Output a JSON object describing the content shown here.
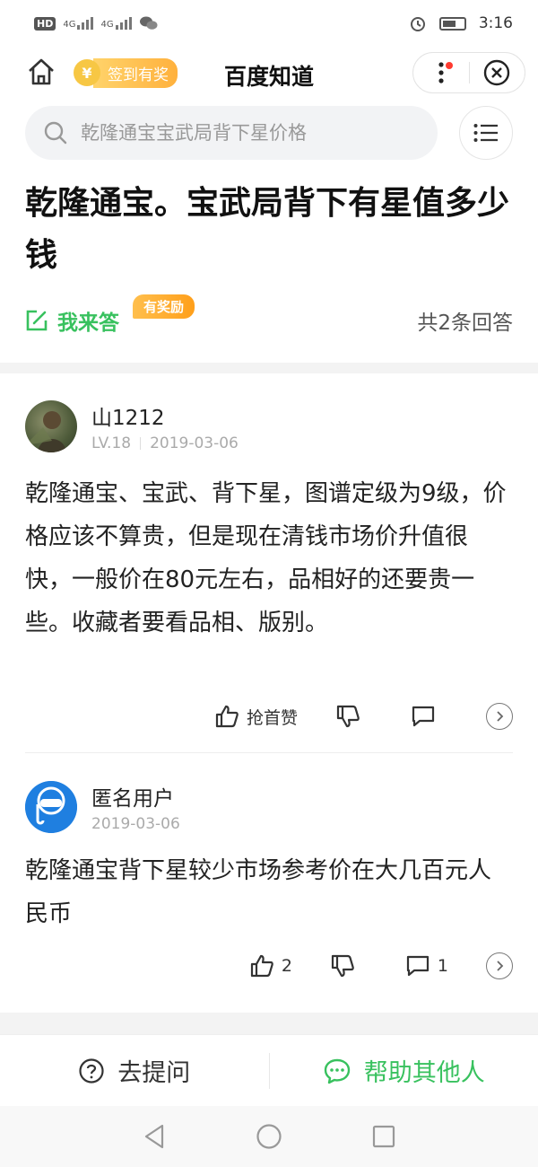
{
  "status_bar": {
    "hd": "HD",
    "net1": "4G",
    "net2": "4G",
    "time": "3:16"
  },
  "header": {
    "coin_symbol": "¥",
    "signin_label": "签到有奖",
    "title": "百度知道"
  },
  "search": {
    "placeholder": "乾隆通宝宝武局背下星价格"
  },
  "question": {
    "title": "乾隆通宝。宝武局背下有星值多少钱",
    "answer_button": "我来答",
    "reward_badge": "有奖励",
    "answer_count": "共2条回答"
  },
  "answers": [
    {
      "username": "山1212",
      "level": "LV.18",
      "date": "2019-03-06",
      "text": "乾隆通宝、宝武、背下星，图谱定级为9级，价格应该不算贵，但是现在清钱市场价升值很快，一般价在80元左右，品相好的还要贵一些。收藏者要看品相、版别。",
      "like_label": "抢首赞"
    },
    {
      "username": "匿名用户",
      "date": "2019-03-06",
      "text": "乾隆通宝背下星较少市场参考价在大几百元人民币",
      "like_count": "2",
      "comment_count": "1"
    }
  ],
  "bottom_bar": {
    "ask_label": "去提问",
    "help_label": "帮助其他人"
  },
  "colors": {
    "accent_green": "#38c15e",
    "reward_orange": "#ffa726"
  }
}
